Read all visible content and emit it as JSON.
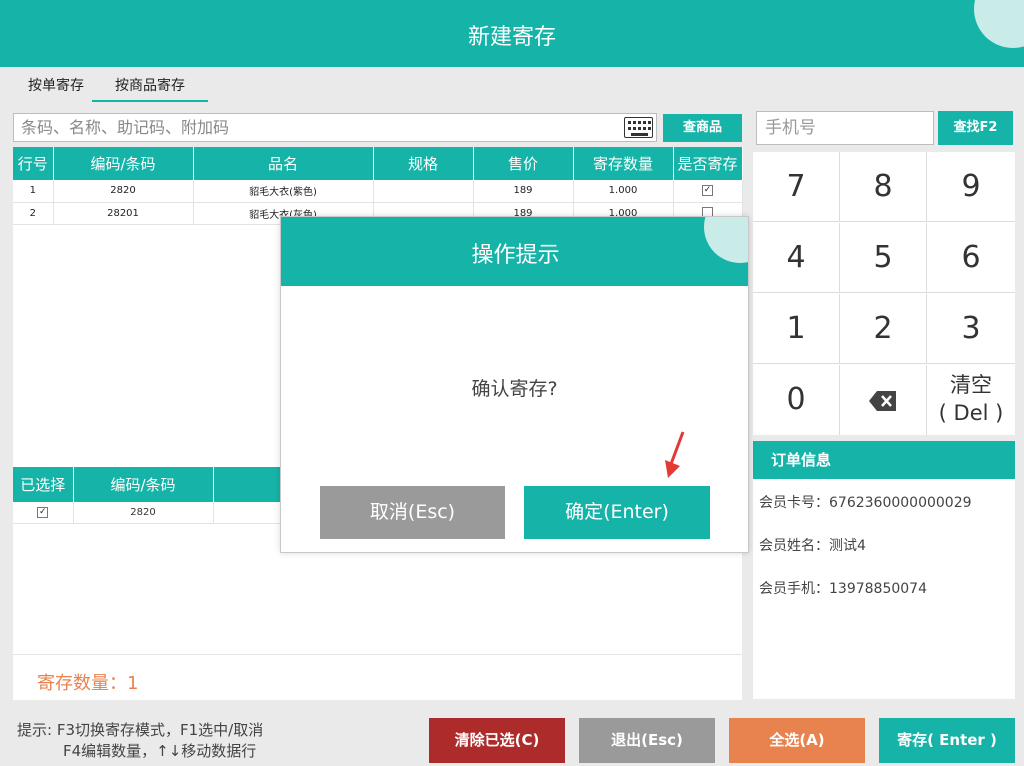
{
  "window": {
    "title": "新建寄存"
  },
  "tabs": [
    {
      "label": "按单寄存"
    },
    {
      "label": "按商品寄存"
    }
  ],
  "search": {
    "placeholder": "条码、名称、助记码、附加码",
    "button_label": "查商品"
  },
  "product_table": {
    "headers": [
      "行号",
      "编码/条码",
      "品名",
      "规格",
      "售价",
      "寄存数量",
      "是否寄存"
    ],
    "rows": [
      {
        "no": "1",
        "code": "2820",
        "name": "貂毛大衣(紫色)",
        "spec": "",
        "price": "189",
        "qty": "1.000",
        "checked": "✓"
      },
      {
        "no": "2",
        "code": "28201",
        "name": "貂毛大衣(灰色)",
        "spec": "",
        "price": "189",
        "qty": "1.000",
        "checked": ""
      }
    ]
  },
  "selected_table": {
    "headers": [
      "已选择",
      "编码/条码",
      ""
    ],
    "rows": [
      {
        "checked": "✓",
        "code": "2820"
      }
    ]
  },
  "count": {
    "text": "寄存数量：1"
  },
  "phone": {
    "placeholder": "手机号",
    "find_label": "查找F2"
  },
  "keypad": {
    "keys": [
      "7",
      "8",
      "9",
      "4",
      "5",
      "6",
      "1",
      "2",
      "3",
      "0"
    ],
    "backspace_icon": "backspace-icon",
    "clear_line1": "清空",
    "clear_line2": "( Del )"
  },
  "order_info": {
    "title": "订单信息",
    "card_label": "会员卡号：",
    "card_value": "6762360000000029",
    "name_label": "会员姓名：",
    "name_value": "测试4",
    "phone_label": "会员手机：",
    "phone_value": "13978850074"
  },
  "hint": {
    "line1": "提示: F3切换寄存模式，F1选中/取消",
    "line2": "F4编辑数量，↑↓移动数据行"
  },
  "footer_buttons": {
    "clear": "清除已选(C)",
    "exit": "退出(Esc)",
    "select_all": "全选(A)",
    "save": "寄存( Enter )"
  },
  "modal": {
    "title": "操作提示",
    "message": "确认寄存?",
    "cancel": "取消(Esc)",
    "ok": "确定(Enter)"
  },
  "colors": {
    "accent": "#16b3a8",
    "danger": "#ad2b2b",
    "neutral": "#9a9a9a",
    "orange": "#e8834f"
  }
}
